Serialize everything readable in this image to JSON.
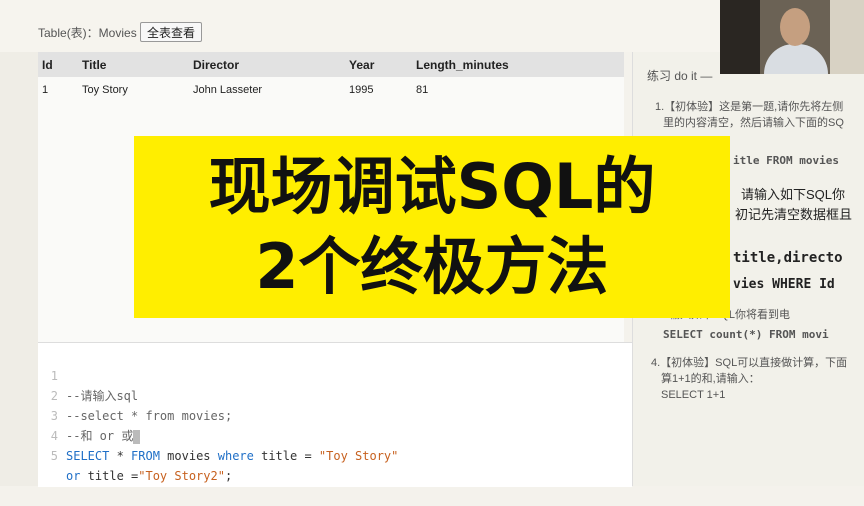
{
  "header": {
    "table_label": "Table(表)：Movies",
    "show_all_button": "全表查看"
  },
  "results_table": {
    "columns": [
      "Id",
      "Title",
      "Director",
      "Year",
      "Length_minutes"
    ],
    "rows": [
      [
        "1",
        "Toy Story",
        "John Lasseter",
        "1995",
        "81"
      ]
    ]
  },
  "editor": {
    "lines": [
      {
        "num": "1",
        "text": "--请输入sql"
      },
      {
        "num": "2",
        "text": "--select * from movies;"
      },
      {
        "num": "3",
        "text": "--和 or 或"
      },
      {
        "num": "4",
        "kw1": "SELECT",
        "op": " * ",
        "kw2": "FROM",
        "t1": " movies ",
        "kw3": "where",
        "t2": " title = ",
        "s1": "\"Toy Story\""
      },
      {
        "num": "5",
        "kw1": "or",
        "t1": " title =",
        "s1": "\"Toy Story2\"",
        "t2": ";"
      }
    ]
  },
  "exercise_panel": {
    "title": "练习 do it —",
    "items": [
      "1.【初体验】这是第一题,请你先将左侧",
      "里的内容清空，然后请输入下面的SQ",
      "itle FROM movies",
      "请输入如下SQL你",
      "初记先清空数据框且",
      "title,directo",
      "vies WHERE Id",
      "输入如下SQL你将看到电",
      "SELECT count(*) FROM movi",
      "4.【初体验】SQL可以直接做计算，下面",
      "算1+1的和,请输入：",
      "SELECT 1+1"
    ]
  },
  "overlay": {
    "line1": "现场调试SQL的",
    "line2": "2个终极方法"
  },
  "colors": {
    "overlay_bg": "#ffee00",
    "keyword": "#1f6fc7",
    "string": "#c7611f"
  }
}
